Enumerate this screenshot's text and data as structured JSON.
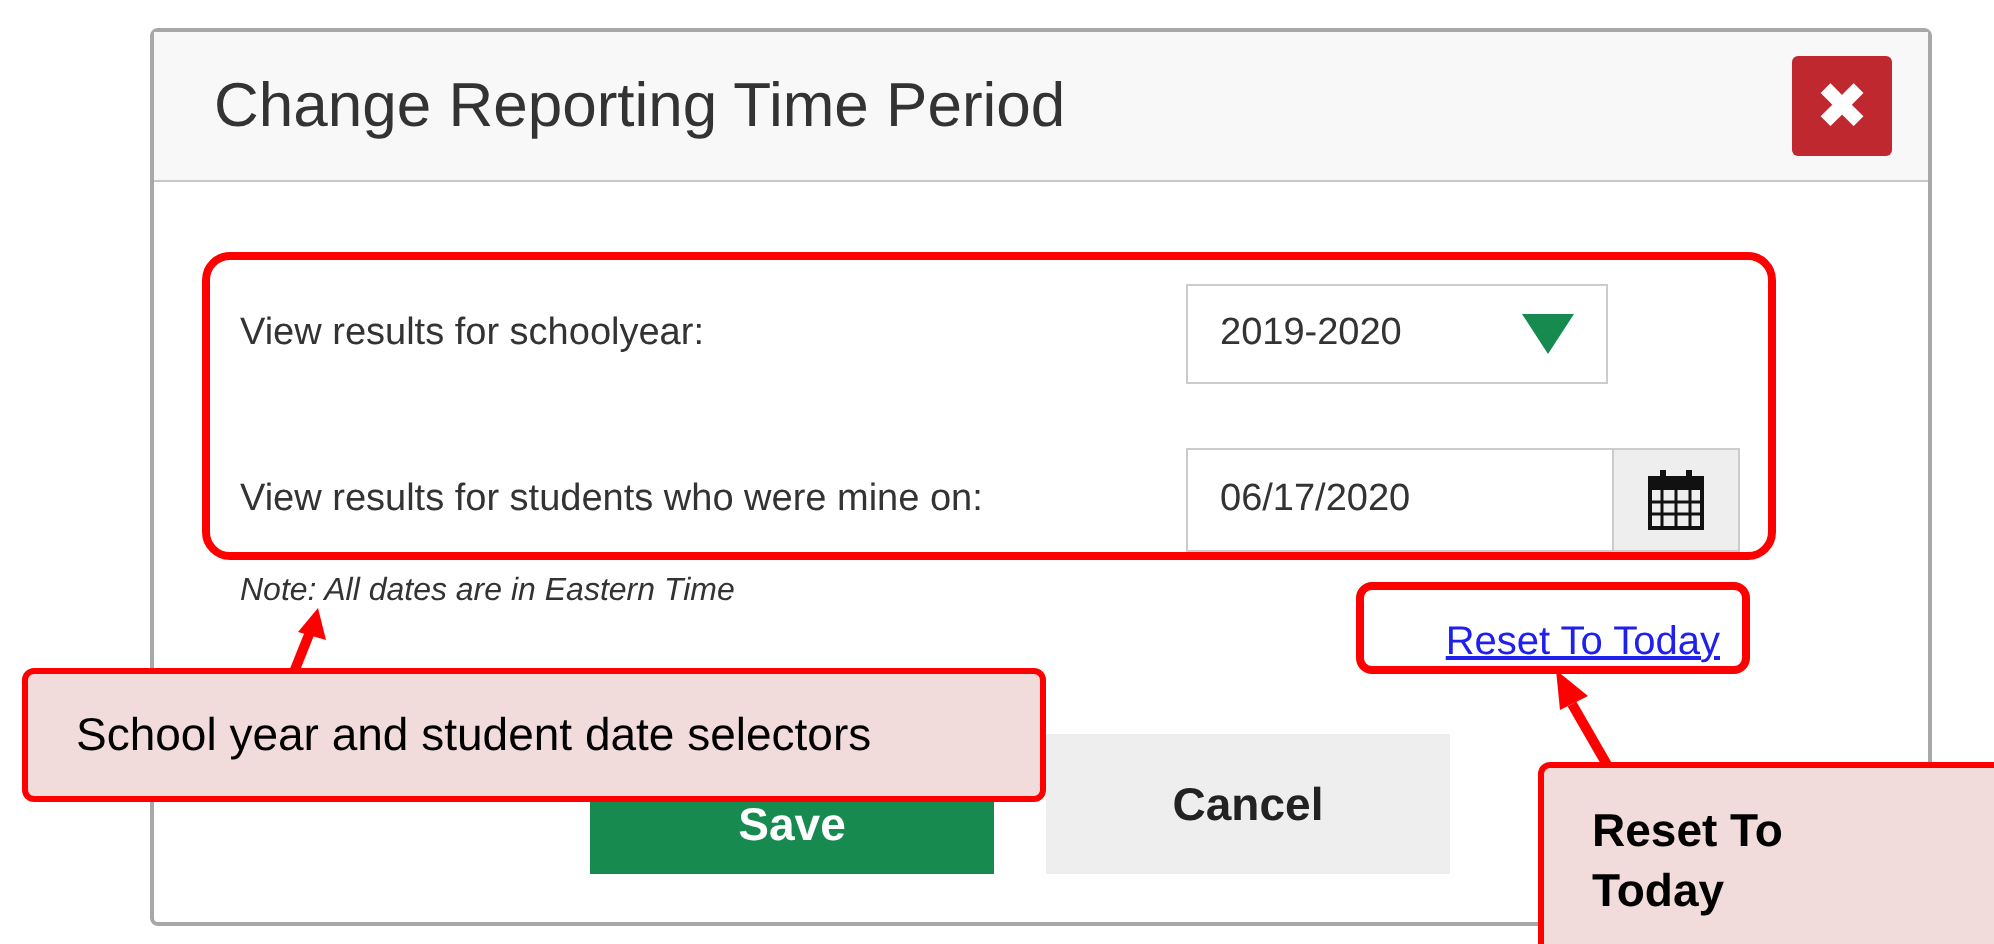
{
  "dialog": {
    "title": "Change Reporting Time Period",
    "close_icon": "✖",
    "fields": [
      {
        "kind": "select",
        "label": "View results for schoolyear:",
        "value": "2019-2020"
      },
      {
        "kind": "date",
        "label": "View results for students who were mine on:",
        "value": "06/17/2020"
      }
    ],
    "note": "Note: All dates are in Eastern Time",
    "reset_link": "Reset To Today",
    "buttons": [
      {
        "label": "Save",
        "kind": "primary"
      },
      {
        "label": "Cancel",
        "kind": "secondary"
      }
    ]
  },
  "callouts": [
    {
      "text": "School year and student date selectors"
    },
    {
      "text": "Reset To Today"
    }
  ]
}
